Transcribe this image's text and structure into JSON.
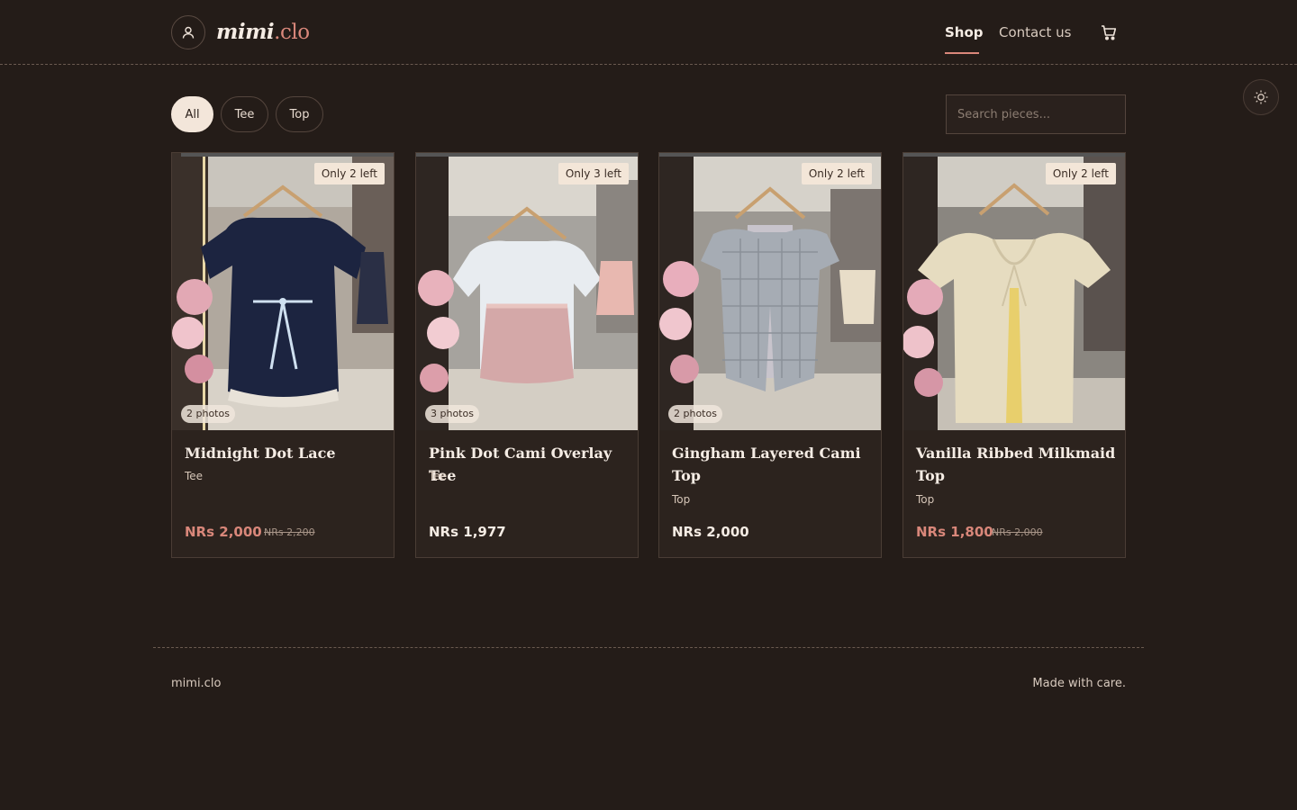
{
  "header": {
    "brand_part1": "mimi",
    "brand_part2": ".clo",
    "nav": {
      "shop": "Shop",
      "contact": "Contact us"
    },
    "icons": {
      "account": "user-icon",
      "cart": "cart-icon",
      "theme": "sun-icon"
    }
  },
  "filters": {
    "chips": [
      "All",
      "Tee",
      "Top"
    ],
    "active": "All",
    "search_placeholder": "Search pieces..."
  },
  "products": [
    {
      "title": "Midnight Dot Lace",
      "category": "Tee",
      "stock": "Only 2 left",
      "photos": "2 photos",
      "price": "NRs 2,000",
      "old_price": "NRs 2,200",
      "on_sale": true
    },
    {
      "title": "Pink Dot Cami Overlay Tee",
      "category": "Tee",
      "stock": "Only 3 left",
      "photos": "3 photos",
      "price": "NRs 1,977",
      "old_price": "",
      "on_sale": false
    },
    {
      "title": "Gingham Layered Cami Top",
      "category": "Top",
      "stock": "Only 2 left",
      "photos": "2 photos",
      "price": "NRs 2,000",
      "old_price": "",
      "on_sale": false
    },
    {
      "title": "Vanilla Ribbed Milkmaid Top",
      "category": "Top",
      "stock": "Only 2 left",
      "photos": "",
      "price": "NRs 1,800",
      "old_price": "NRs 2,000",
      "on_sale": true
    }
  ],
  "footer": {
    "left": "mimi.clo",
    "right": "Made with care."
  },
  "colors": {
    "background": "#241c18",
    "accent": "#d9877a",
    "card": "#2c231e"
  }
}
